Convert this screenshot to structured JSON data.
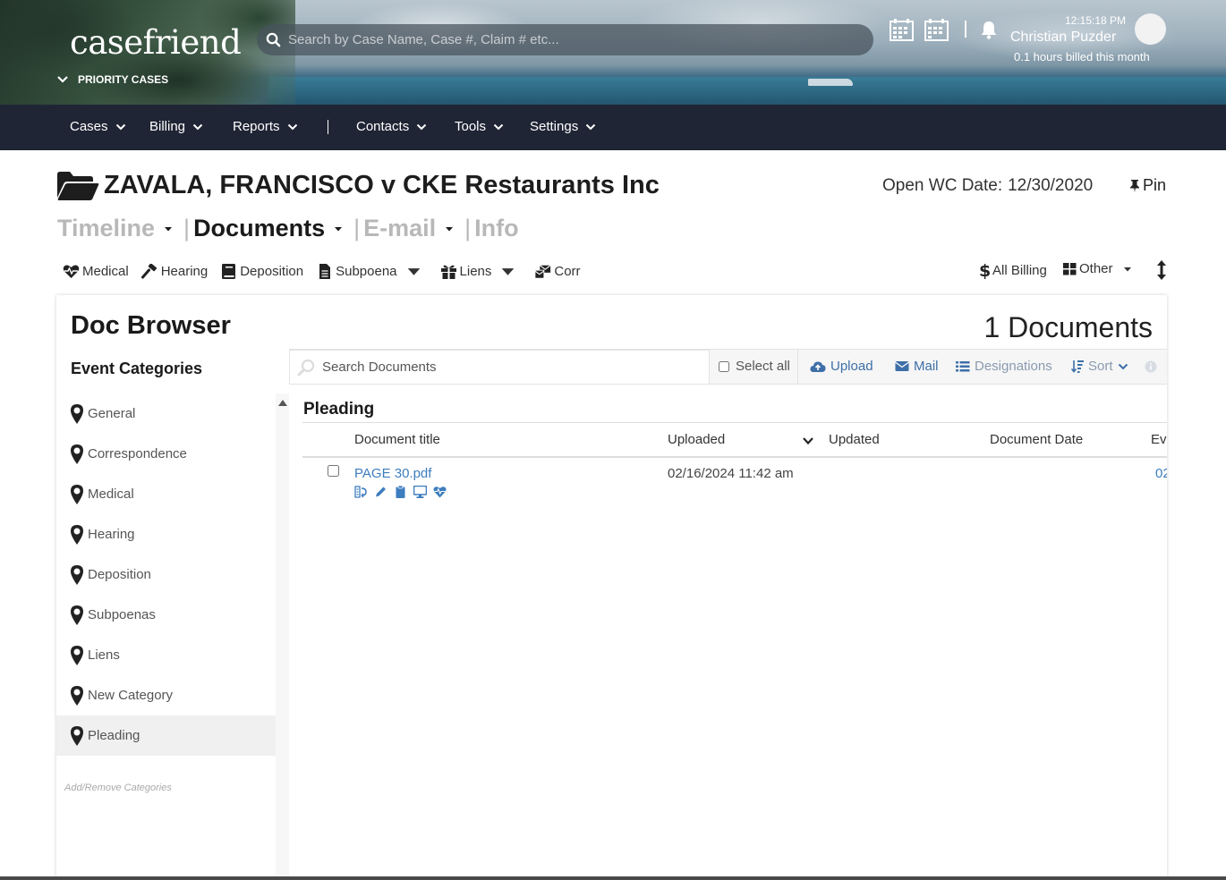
{
  "header": {
    "logo": "casefriend",
    "priority_cases": "PRIORITY CASES",
    "search_placeholder": "Search by Case Name, Case #, Claim # etc...",
    "time": "12:15:18 PM",
    "user_name": "Christian Puzder",
    "billed": "0.1 hours billed this month",
    "icons": [
      "calendar-grid-icon",
      "calendar-grid-icon",
      "bell-icon"
    ]
  },
  "nav": {
    "items": [
      {
        "label": "Cases"
      },
      {
        "label": "Billing"
      },
      {
        "label": "Reports"
      },
      {
        "label": "Contacts"
      },
      {
        "label": "Tools"
      },
      {
        "label": "Settings"
      }
    ],
    "separator": "|"
  },
  "case": {
    "title": "ZAVALA, FRANCISCO v CKE Restaurants Inc",
    "open_label": "Open WC Date:",
    "open_date": "12/30/2020",
    "pin_label": "Pin"
  },
  "tabs": [
    {
      "label": "Timeline",
      "active": false
    },
    {
      "label": "Documents",
      "active": true
    },
    {
      "label": "E-mail",
      "active": false
    },
    {
      "label": "Info",
      "active": false
    }
  ],
  "subtoolbar": {
    "items": [
      {
        "label": "Medical",
        "icon": "heartbeat-icon"
      },
      {
        "label": "Hearing",
        "icon": "gavel-icon"
      },
      {
        "label": "Deposition",
        "icon": "book-icon"
      },
      {
        "label": "Subpoena",
        "icon": "file-icon"
      },
      {
        "label": "Liens",
        "icon": "gift-icon"
      },
      {
        "label": "Corr",
        "icon": "mail-bulk-icon"
      }
    ],
    "all_billing": "All Billing",
    "other": "Other"
  },
  "doc_browser": {
    "title": "Doc Browser",
    "count_label": "1 Documents",
    "event_categories_title": "Event Categories",
    "categories": [
      {
        "label": "General"
      },
      {
        "label": "Correspondence"
      },
      {
        "label": "Medical"
      },
      {
        "label": "Hearing"
      },
      {
        "label": "Deposition"
      },
      {
        "label": "Subpoenas"
      },
      {
        "label": "Liens"
      },
      {
        "label": "New Category"
      },
      {
        "label": "Pleading"
      }
    ],
    "selected_category": "Pleading",
    "add_remove": "Add/Remove Categories",
    "toolbar": {
      "search_placeholder": "Search Documents",
      "select_all": "Select all",
      "upload": "Upload",
      "mail": "Mail",
      "designations": "Designations",
      "sort": "Sort"
    },
    "section": "Pleading",
    "columns": [
      "Document title",
      "Uploaded",
      "Updated",
      "Document Date",
      "Eve"
    ],
    "rows": [
      {
        "title": "PAGE 30.pdf",
        "uploaded": "02/16/2024 11:42 am",
        "updated": "",
        "document_date": "",
        "event": "02"
      }
    ],
    "row_icons": [
      "scan-icon",
      "pencil-icon",
      "clipboard-icon",
      "desktop-icon",
      "heartbeat-icon"
    ]
  },
  "colors": {
    "nav_bg": "#202535",
    "link_blue": "#3d7dbf",
    "toolbar_blue": "#3d6fa8"
  }
}
